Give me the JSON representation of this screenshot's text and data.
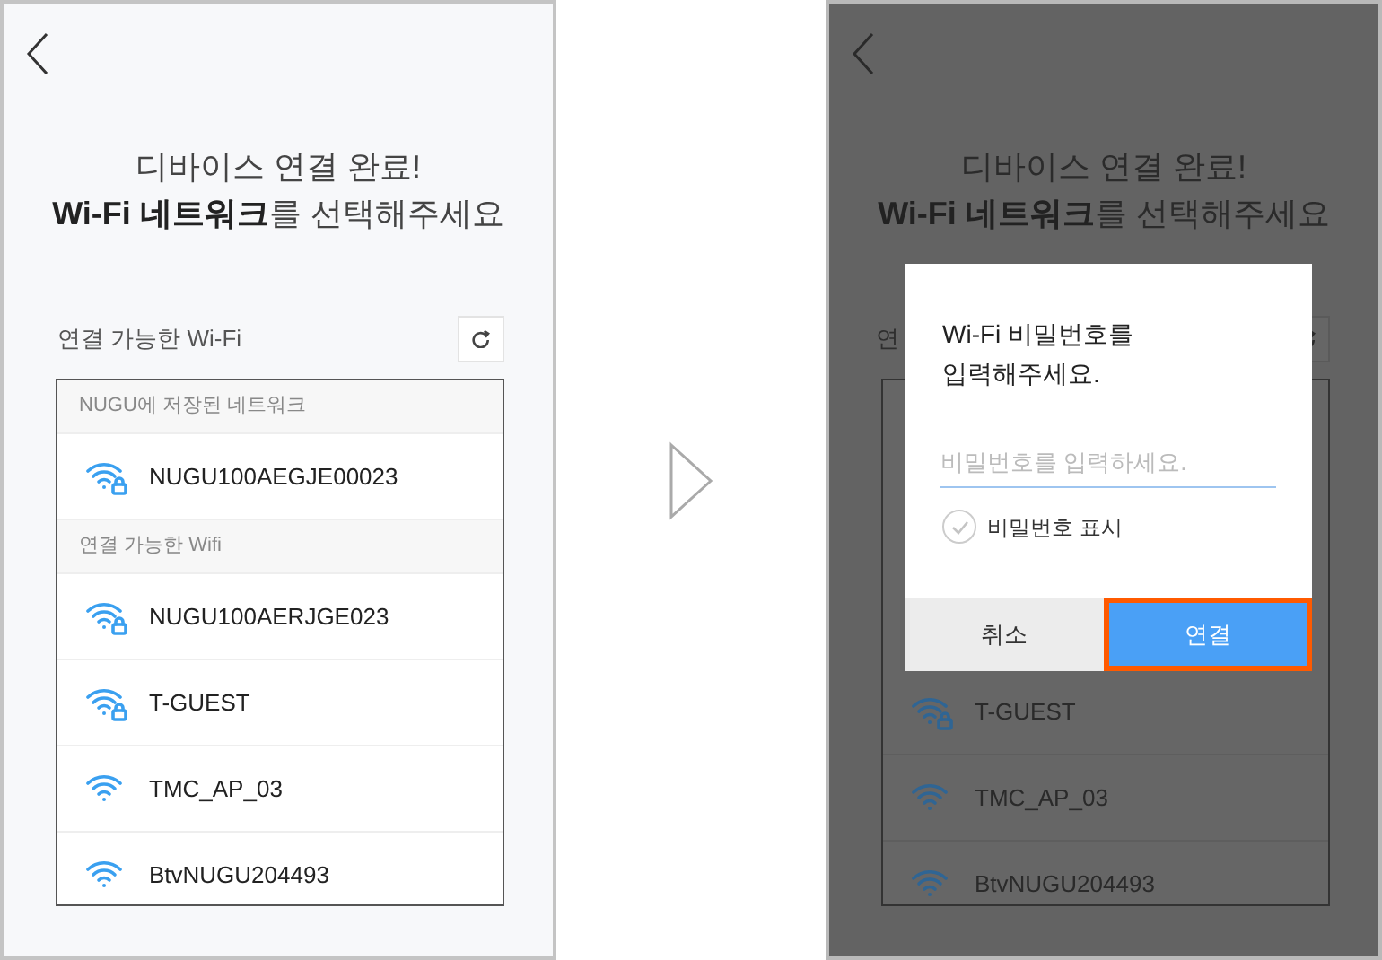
{
  "screens": [
    {
      "dimmed": false,
      "heading_line1": "디바이스 연결 완료!",
      "heading_line2": "**Wi-Fi 네트워크**를 선택해주세요",
      "list_label": "연결 가능한 Wi-Fi",
      "sections": [
        {
          "header": "NUGU에 저장된 네트워크",
          "networks": [
            {
              "ssid": "NUGU100AEGJE00023",
              "locked": true
            }
          ]
        },
        {
          "header": "연결 가능한 Wifi",
          "networks": [
            {
              "ssid": "NUGU100AERJGE023",
              "locked": true
            },
            {
              "ssid": "T-GUEST",
              "locked": true
            },
            {
              "ssid": "TMC_AP_03",
              "locked": false
            },
            {
              "ssid": "BtvNUGU204493",
              "locked": false
            }
          ]
        }
      ]
    },
    {
      "dimmed": true,
      "heading_line1": "디바이스 연결 완료!",
      "heading_line2": "**Wi-Fi 네트워크**를 선택해주세요",
      "list_label": "연",
      "sections": [
        {
          "networks": [
            {
              "ssid": "T-GUEST",
              "locked": true
            },
            {
              "ssid": "TMC_AP_03",
              "locked": false
            },
            {
              "ssid": "BtvNUGU204493",
              "locked": false
            }
          ]
        }
      ]
    }
  ],
  "dialog": {
    "title": "Wi-Fi 비밀번호를\n입력해주세요.",
    "placeholder": "비밀번호를 입력하세요.",
    "show_password": {
      "label": "비밀번호 표시",
      "checked": false
    },
    "buttons": [
      {
        "label": "취소",
        "kind": "cancel",
        "highlighted": false
      },
      {
        "label": "연결",
        "kind": "confirm",
        "highlighted": true
      }
    ]
  }
}
